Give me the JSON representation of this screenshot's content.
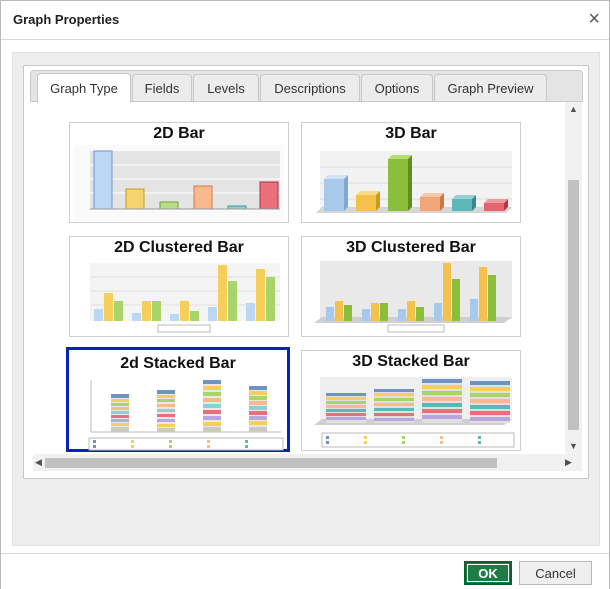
{
  "dialog": {
    "title": "Graph Properties",
    "close_label": "×"
  },
  "tabs": [
    "Graph Type",
    "Fields",
    "Levels",
    "Descriptions",
    "Options",
    "Graph Preview"
  ],
  "graph_types": [
    {
      "label": "2D Bar"
    },
    {
      "label": "3D Bar"
    },
    {
      "label": "2D Clustered Bar"
    },
    {
      "label": "3D Clustered Bar"
    },
    {
      "label": "2d Stacked Bar",
      "selected": true
    },
    {
      "label": "3D Stacked Bar"
    }
  ],
  "footer": {
    "ok_label": "OK",
    "cancel_label": "Cancel"
  },
  "colors": {
    "selected_border": "#0a23b4",
    "ok_button": "#1e7d45"
  }
}
